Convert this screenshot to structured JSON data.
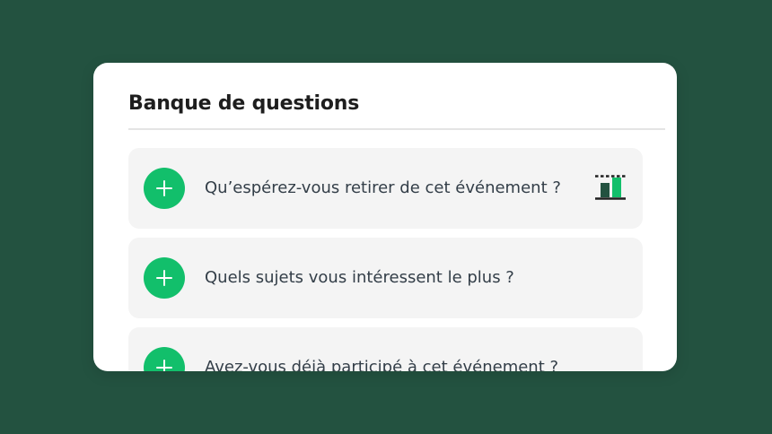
{
  "question_bank": {
    "title": "Banque de questions",
    "questions": [
      {
        "text": "Qu’espérez-vous retirer de cet événement ?",
        "icon": "bar-chart-icon",
        "has_chart_icon": true
      },
      {
        "text": "Quels sujets vous intéressent le plus ?",
        "has_chart_icon": false
      },
      {
        "text": "Avez-vous déjà participé à cet événement ?",
        "has_chart_icon": false
      }
    ],
    "add_icon": "plus-icon"
  },
  "colors": {
    "background": "#235240",
    "card": "#ffffff",
    "item_background": "#f4f4f4",
    "accent_green": "#12bf6b",
    "text": "#333e48",
    "title": "#1e1e1e"
  }
}
